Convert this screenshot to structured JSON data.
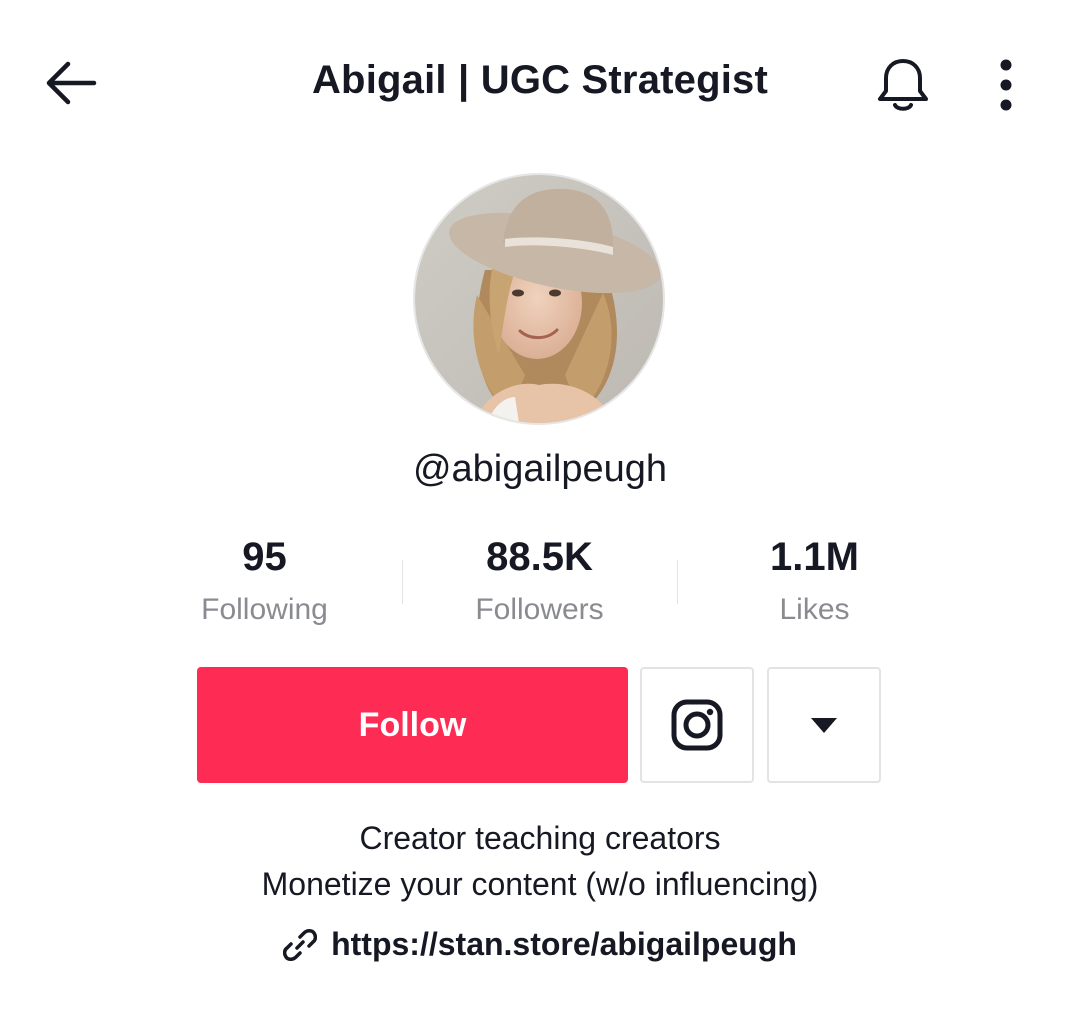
{
  "header": {
    "title": "Abigail | UGC Strategist",
    "back_icon": "arrow-left-icon",
    "notification_icon": "bell-icon",
    "more_icon": "more-vertical-icon"
  },
  "profile": {
    "handle": "@abigailpeugh",
    "stats": [
      {
        "value": "95",
        "label": "Following"
      },
      {
        "value": "88.5K",
        "label": "Followers"
      },
      {
        "value": "1.1M",
        "label": "Likes"
      }
    ]
  },
  "actions": {
    "follow_label": "Follow",
    "instagram_icon": "instagram-icon",
    "dropdown_icon": "caret-down-icon"
  },
  "bio": {
    "line1": "Creator teaching creators",
    "line2": "Monetize your content (w/o influencing)",
    "link": "https://stan.store/abigailpeugh",
    "link_icon": "link-icon"
  },
  "colors": {
    "accent": "#fe2c55",
    "text_primary": "#161823",
    "text_secondary": "#8a8b91",
    "border": "#e3e3e4"
  }
}
